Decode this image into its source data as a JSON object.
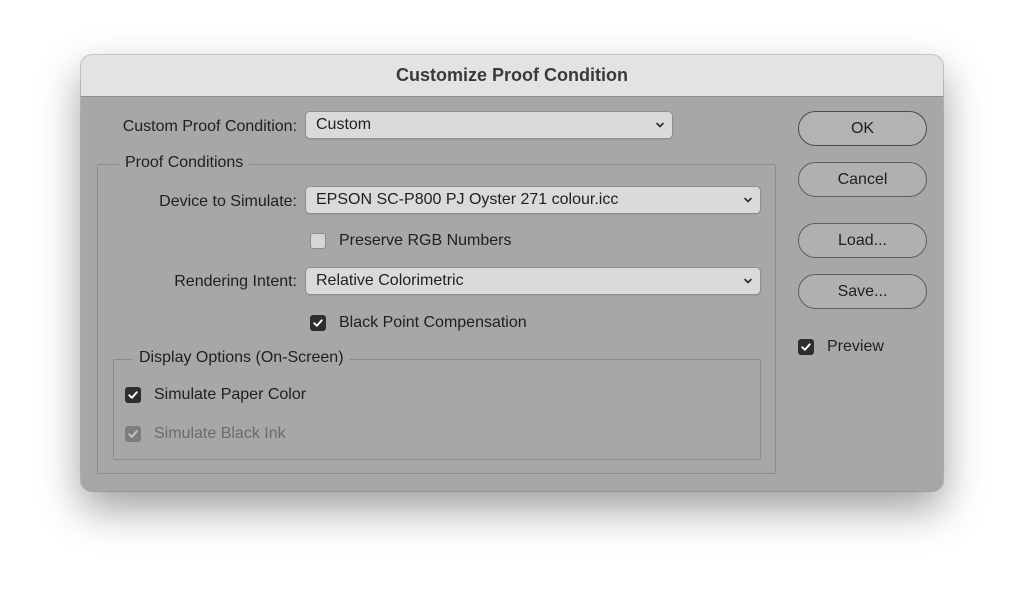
{
  "dialog": {
    "title": "Customize Proof Condition"
  },
  "custom_proof": {
    "label": "Custom Proof Condition:",
    "value": "Custom"
  },
  "proof_conditions": {
    "legend": "Proof Conditions",
    "device_label": "Device to Simulate:",
    "device_value": "EPSON SC-P800 PJ Oyster 271 colour.icc",
    "preserve_rgb": {
      "label": "Preserve RGB Numbers",
      "checked": false
    },
    "intent_label": "Rendering Intent:",
    "intent_value": "Relative Colorimetric",
    "black_point": {
      "label": "Black Point Compensation",
      "checked": true
    }
  },
  "display_options": {
    "legend": "Display Options (On-Screen)",
    "paper_color": {
      "label": "Simulate Paper Color",
      "checked": true
    },
    "black_ink": {
      "label": "Simulate Black Ink",
      "checked": true,
      "disabled": true
    }
  },
  "buttons": {
    "ok": "OK",
    "cancel": "Cancel",
    "load": "Load...",
    "save": "Save..."
  },
  "preview": {
    "label": "Preview",
    "checked": true
  },
  "icons": {
    "chevron": "chevron-down-icon",
    "check": "checkmark-icon"
  },
  "colors": {
    "dialog_background": "#a7a7a7",
    "titlebar": "#e3e3e3"
  }
}
